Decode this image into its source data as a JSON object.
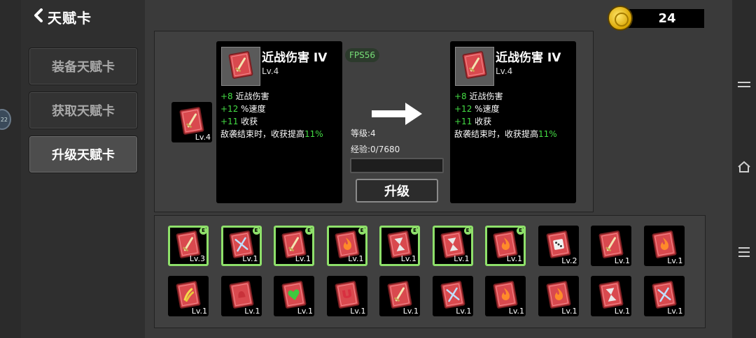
{
  "header": {
    "back_label": "天赋卡",
    "coins": "24"
  },
  "system": {
    "bubble_text": "22"
  },
  "tabs": [
    {
      "label": "装备天赋卡",
      "active": false
    },
    {
      "label": "获取天赋卡",
      "active": false
    },
    {
      "label": "升级天赋卡",
      "active": true
    }
  ],
  "fps_badge": "FPS56",
  "selected_card": {
    "level": "Lv.4",
    "icon": "sword-card-icon"
  },
  "current": {
    "name": "近战伤害 IV",
    "level": "Lv.4",
    "stats": [
      {
        "value": "+8",
        "label": "近战伤害"
      },
      {
        "value": "+12",
        "label": "%速度"
      },
      {
        "value": "+11",
        "label": "收获"
      }
    ],
    "bonus_text": "敌袭结束时，收获提高",
    "bonus_value": "11%"
  },
  "next": {
    "name": "近战伤害 IV",
    "level": "Lv.4",
    "stats": [
      {
        "value": "+8",
        "label": "近战伤害"
      },
      {
        "value": "+12",
        "label": "%速度"
      },
      {
        "value": "+11",
        "label": "收获"
      }
    ],
    "bonus_text": "敌袭结束时，收获提高",
    "bonus_value": "11%"
  },
  "progress": {
    "level_text": "等级:4",
    "exp_text": "经验:0/7680",
    "exp_fraction": 0.0
  },
  "upgrade_label": "升级",
  "colors": {
    "card_red": "#d9494e",
    "card_border": "#7a1f22",
    "equipped_green": "#8ee06a",
    "stat_green": "#44dd44"
  },
  "inventory": [
    {
      "icon": "sword",
      "level": "Lv.3",
      "equipped": true,
      "badge": "E"
    },
    {
      "icon": "crossed-swords",
      "level": "Lv.1",
      "equipped": true,
      "badge": "E"
    },
    {
      "icon": "sword",
      "level": "Lv.1",
      "equipped": true,
      "badge": "E"
    },
    {
      "icon": "fire",
      "level": "Lv.1",
      "equipped": true,
      "badge": "E"
    },
    {
      "icon": "hourglass",
      "level": "Lv.1",
      "equipped": true,
      "badge": "E"
    },
    {
      "icon": "hourglass",
      "level": "Lv.1",
      "equipped": true,
      "badge": "E"
    },
    {
      "icon": "fire",
      "level": "Lv.1",
      "equipped": true,
      "badge": "E"
    },
    {
      "icon": "dice",
      "level": "Lv.2",
      "equipped": false,
      "badge": ""
    },
    {
      "icon": "sword",
      "level": "Lv.1",
      "equipped": false,
      "badge": ""
    },
    {
      "icon": "fire",
      "level": "Lv.1",
      "equipped": false,
      "badge": ""
    },
    {
      "icon": "bananas",
      "level": "Lv.1",
      "equipped": false,
      "badge": ""
    },
    {
      "icon": "hand",
      "level": "Lv.1",
      "equipped": false,
      "badge": ""
    },
    {
      "icon": "heart",
      "level": "Lv.1",
      "equipped": false,
      "badge": ""
    },
    {
      "icon": "magnet",
      "level": "Lv.1",
      "equipped": false,
      "badge": ""
    },
    {
      "icon": "sword",
      "level": "Lv.1",
      "equipped": false,
      "badge": ""
    },
    {
      "icon": "crossed-swords",
      "level": "Lv.1",
      "equipped": false,
      "badge": ""
    },
    {
      "icon": "fire",
      "level": "Lv.1",
      "equipped": false,
      "badge": ""
    },
    {
      "icon": "fire",
      "level": "Lv.1",
      "equipped": false,
      "badge": ""
    },
    {
      "icon": "hourglass",
      "level": "Lv.1",
      "equipped": false,
      "badge": ""
    },
    {
      "icon": "crossed-swords",
      "level": "Lv.1",
      "equipped": false,
      "badge": ""
    }
  ]
}
